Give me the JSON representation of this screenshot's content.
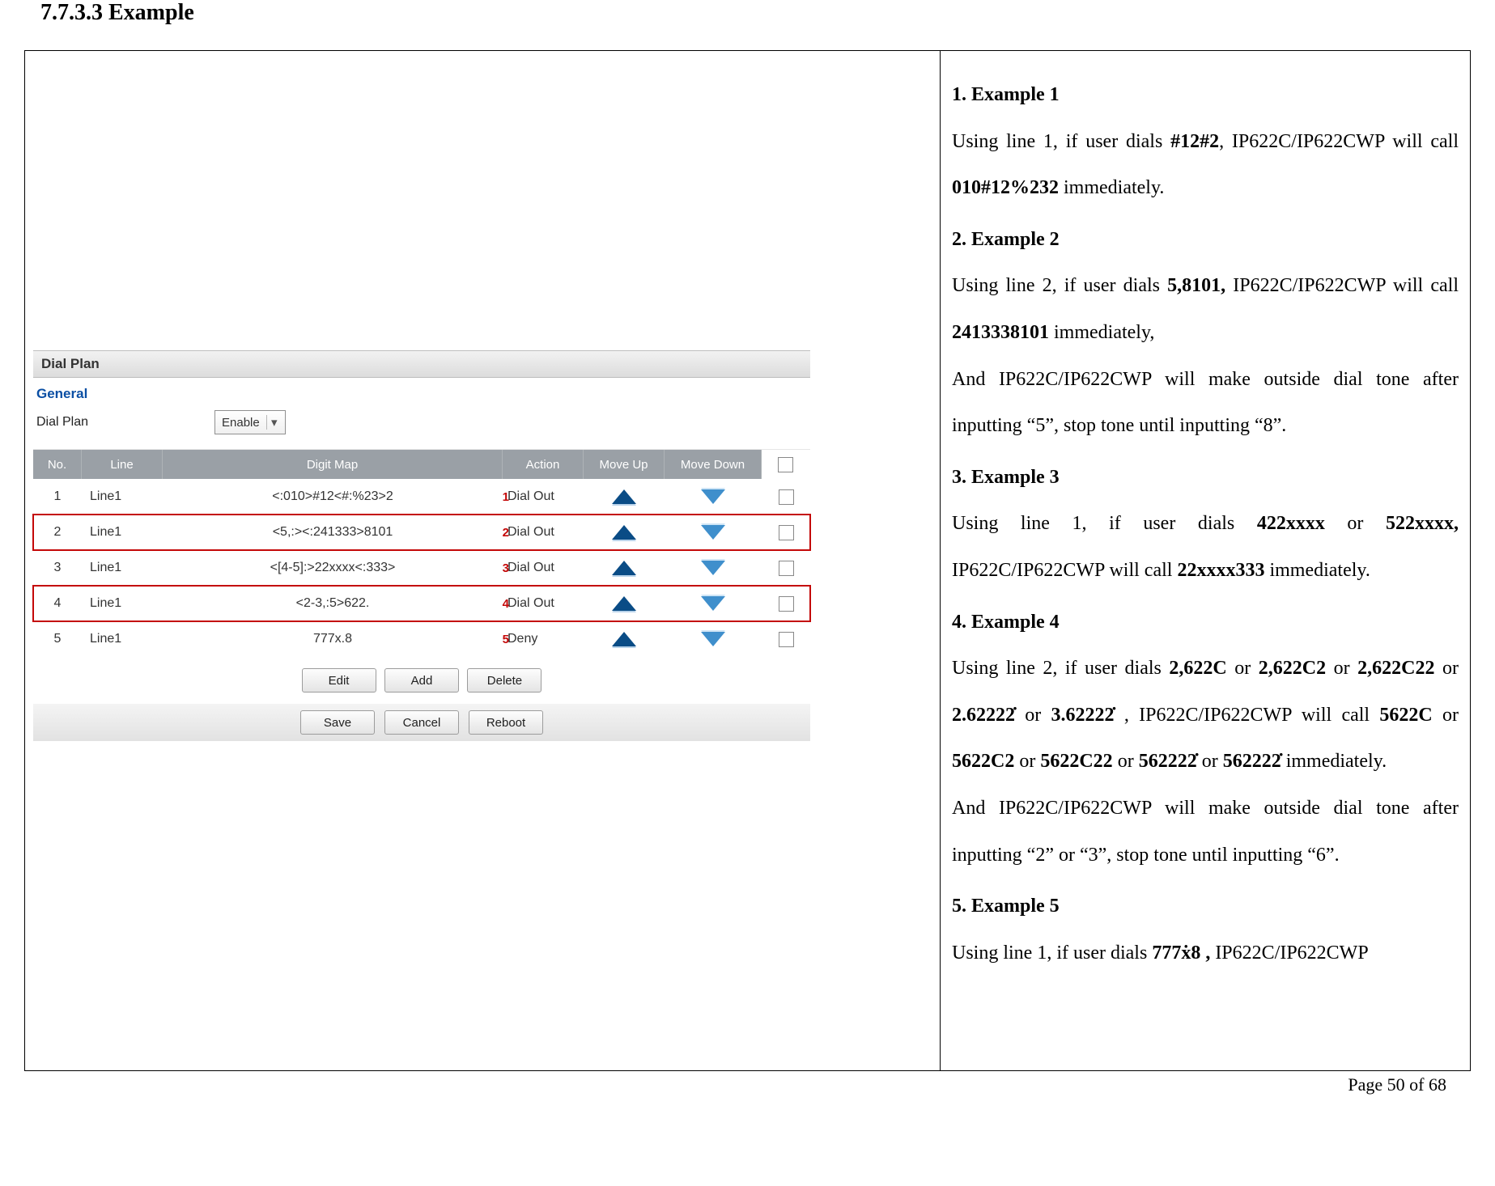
{
  "heading": "7.7.3.3  Example",
  "footer": "Page  50  of  68",
  "shot": {
    "panel_title": "Dial Plan",
    "general": "General",
    "dialplan_label": "Dial Plan",
    "dialplan_value": "Enable",
    "head": {
      "no": "No.",
      "line": "Line",
      "map": "Digit Map",
      "action": "Action",
      "up": "Move Up",
      "down": "Move Down"
    },
    "rows": [
      {
        "no": "1",
        "line": "Line1",
        "map": "<:010>#12<#:%23>2",
        "badge": "1",
        "action": "Dial Out",
        "sel": false
      },
      {
        "no": "2",
        "line": "Line1",
        "map": "<5,:><:241333>8101",
        "badge": "2",
        "action": "Dial Out",
        "sel": true
      },
      {
        "no": "3",
        "line": "Line1",
        "map": "<[4-5]:>22xxxx<:333>",
        "badge": "3",
        "action": "Dial Out",
        "sel": false
      },
      {
        "no": "4",
        "line": "Line1",
        "map": "<2-3,:5>622.",
        "badge": "4",
        "action": "Dial Out",
        "sel": true
      },
      {
        "no": "5",
        "line": "Line1",
        "map": "777x.8",
        "badge": "5",
        "action": "Deny",
        "sel": false
      }
    ],
    "btns1": {
      "edit": "Edit",
      "add": "Add",
      "delete": "Delete"
    },
    "btns2": {
      "save": "Save",
      "cancel": "Cancel",
      "reboot": "Reboot"
    }
  },
  "rhs": {
    "e1h": "1.   Example 1",
    "e1a": "Using  line  1,  if  user  dials  ",
    "e1b": "#12#2",
    "e1c": ",  IP622C/IP622CWP will call ",
    "e1d": "010#12%232",
    "e1e": " immediately.",
    "e2h": "2.   Example 2",
    "e2a": "Using  line  2,  if  user  dials  ",
    "e2b": "5,8101,",
    "e2c": "  IP622C/IP622CWP will call ",
    "e2d": "2413338101",
    "e2e": " immediately,",
    "e2f": "And  IP622C/IP622CWP  will  make  outside  dial  tone after inputting “5”, stop tone until inputting “8”.",
    "e3h": "3.   Example 3",
    "e3a": "Using  line  1,  if  user  dials  ",
    "e3b": "422xxxx",
    "e3c": "  or  ",
    "e3d": "522xxxx,",
    "e3e": " IP622C/IP622CWP will call ",
    "e3f": "22xxxx333",
    "e3g": " immediately.",
    "e4h": "4.   Example 4",
    "e4a": "Using  line  2,  if  user  dials  ",
    "e4b": "2,622C",
    "e4c": "  or  ",
    "e4d": "2,622C2",
    "e4e": "  or ",
    "e4f": "2,622C22",
    "e4g": "     or     ",
    "e4h2": "2.62222̇",
    "e4i": "     or     ",
    "e4j": "3.62222̇",
    "e4k": " , IP622C/IP622CWP  will  call  ",
    "e4l": "5622C",
    "e4m": "  or  ",
    "e4n": "5622C2",
    "e4o": "  or ",
    "e4p": "5622C22",
    "e4q": " or ",
    "e4r": "562222̇",
    "e4s": " or ",
    "e4t": "562222̇",
    "e4u": " immediately.",
    "e4v": "And  IP622C/IP622CWP  will  make  outside  dial  tone after inputting “2” or “3”, stop tone until inputting “6”.",
    "e5h": "5.   Example 5",
    "e5a": "Using  line  1,  if  user  dials ",
    "e5b": "777ẋ8 ,",
    "e5c": " IP622C/IP622CWP"
  }
}
